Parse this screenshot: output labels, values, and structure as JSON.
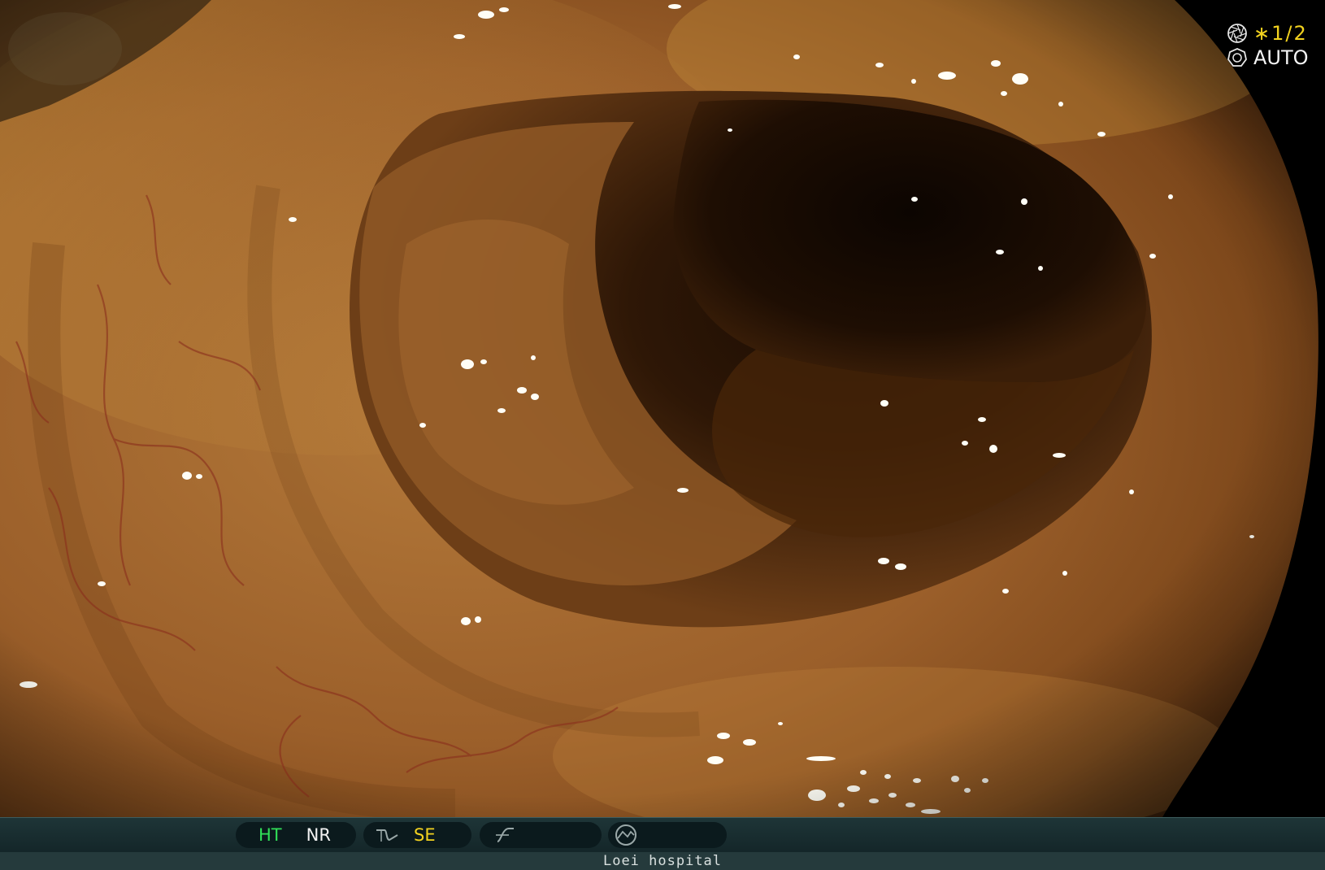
{
  "overlay": {
    "speed_text": "∗1/2",
    "mode_text": "AUTO",
    "speed_icon": "aperture-icon",
    "mode_icon": "iris-icon"
  },
  "statusbar": {
    "ht_label": "HT",
    "nr_label": "NR",
    "se_label": "SE",
    "enhance_icon": "curve-icon",
    "freeze_icon": "slash-curve-icon",
    "scope_icon": "scope-circle-icon",
    "colors": {
      "ht": "#31e058",
      "se": "#f2d21f",
      "bar": "#1e3537"
    }
  },
  "footer": {
    "hospital": "Loei hospital"
  }
}
